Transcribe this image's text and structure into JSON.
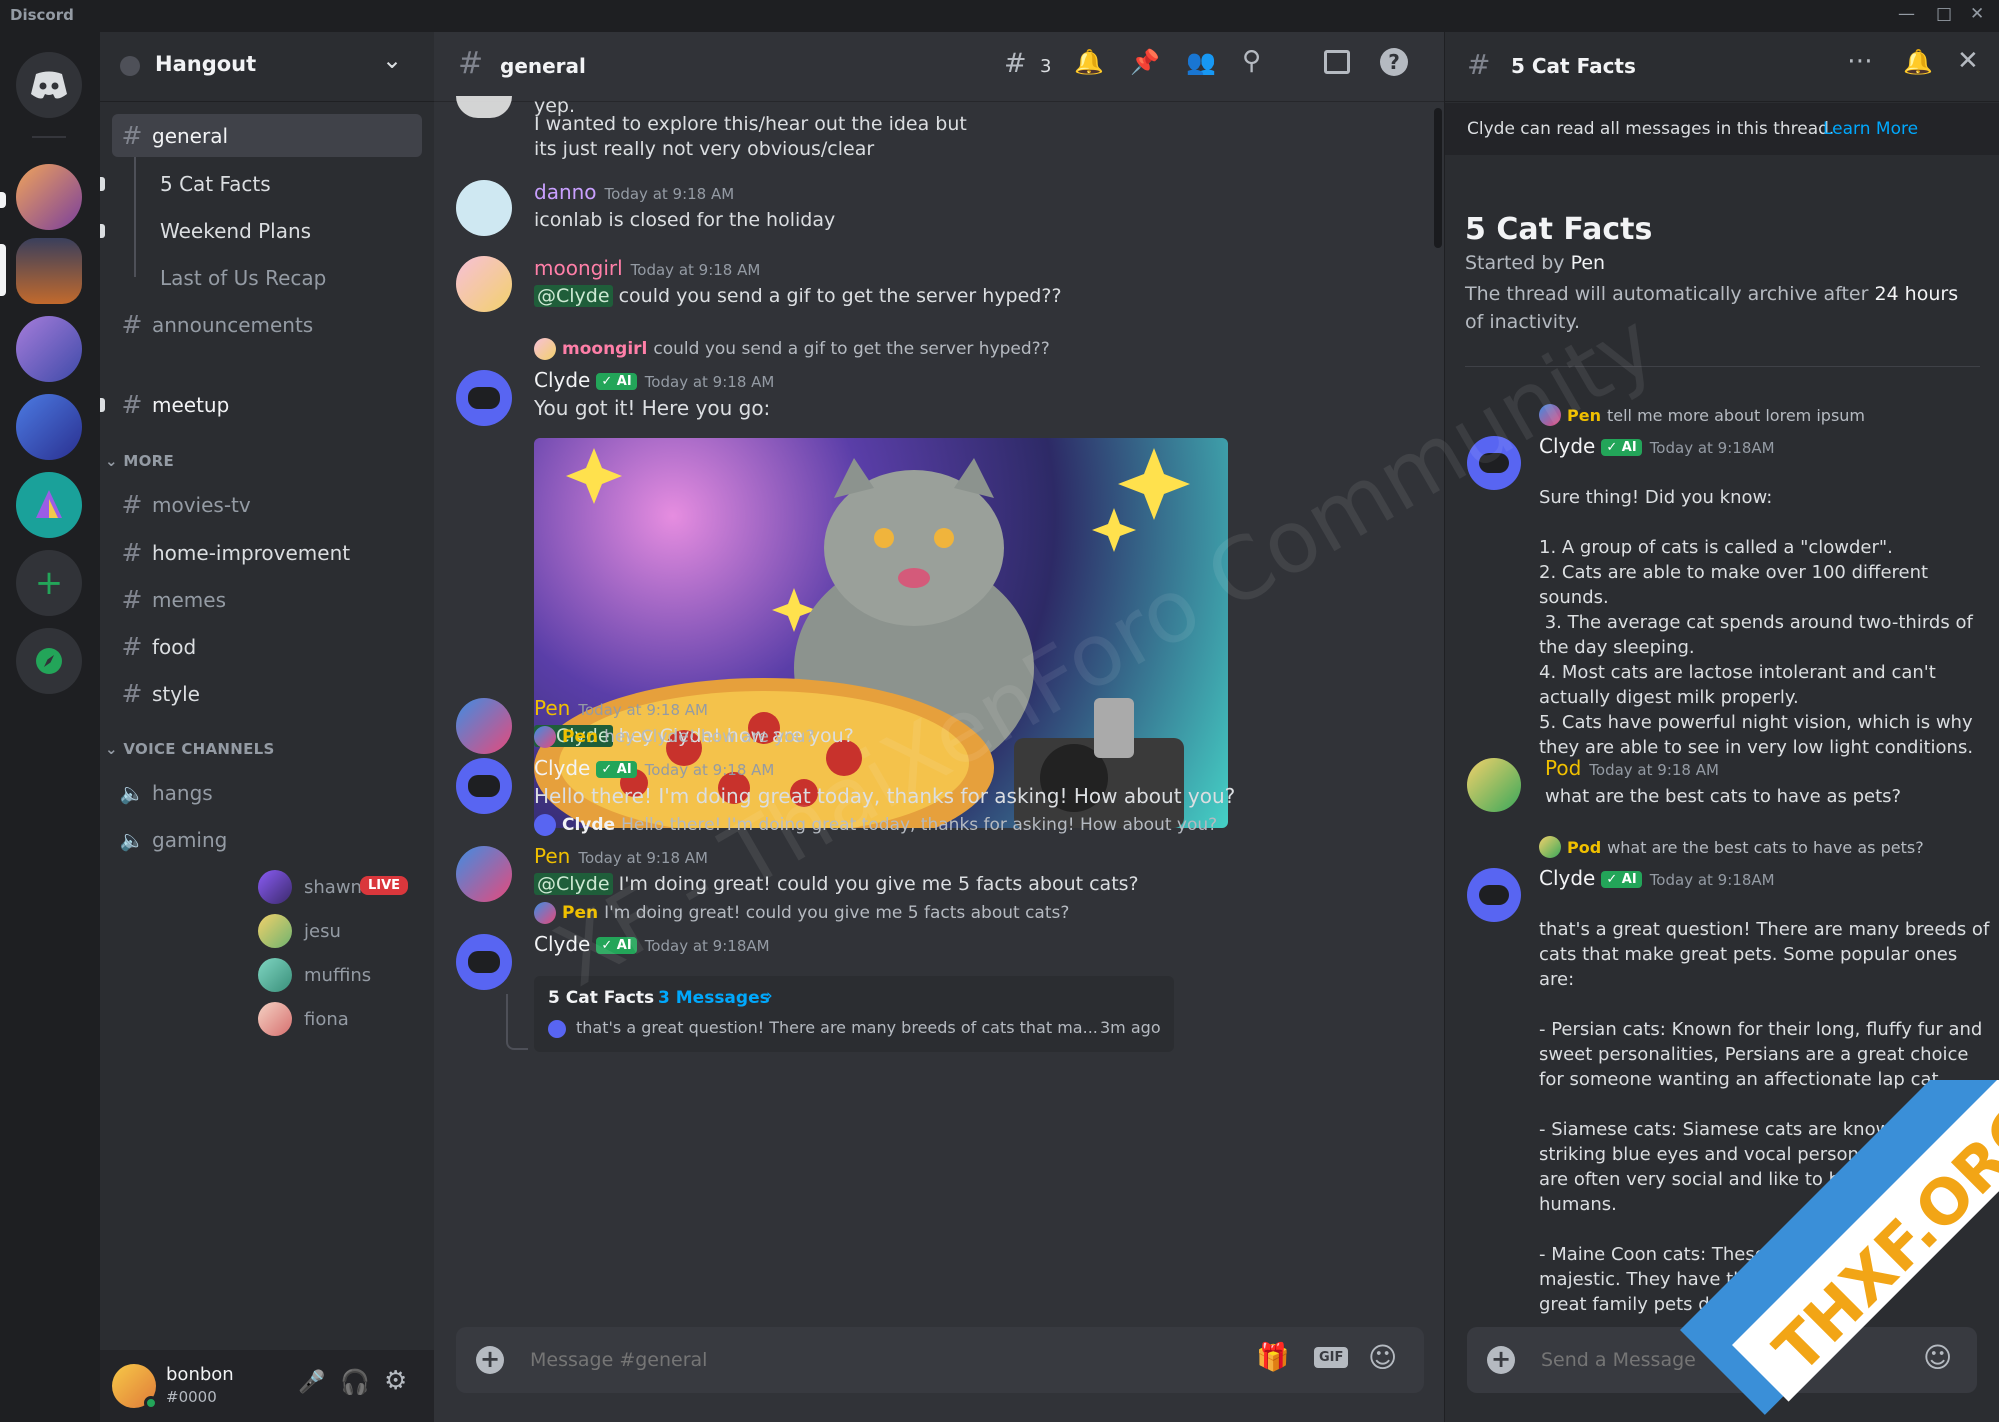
{
  "app": {
    "title": "Discord"
  },
  "colors": {
    "accent": "#5865f2",
    "green": "#23a559",
    "live": "#da373c",
    "link": "#00a8fc"
  },
  "server": {
    "name": "Hangout"
  },
  "channels": {
    "general": "general",
    "threads": [
      "5 Cat Facts",
      "Weekend Plans",
      "Last of Us Recap"
    ],
    "text": [
      "announcements",
      "meetup"
    ],
    "more_label": "MORE",
    "more": [
      "movies-tv",
      "home-improvement",
      "memes",
      "food",
      "style"
    ],
    "voice_label": "VOICE CHANNELS",
    "voice": [
      "hangs",
      "gaming"
    ],
    "voice_users": [
      {
        "name": "shawn",
        "badge": "LIVE"
      },
      {
        "name": "jesu"
      },
      {
        "name": "muffins"
      },
      {
        "name": "fiona"
      }
    ]
  },
  "user": {
    "name": "bonbon",
    "tag": "#0000"
  },
  "chat": {
    "channel": "general",
    "thread_count": "3",
    "composer_placeholder": "Message #general",
    "gif_label": "GIF",
    "top_lines": [
      "yep.",
      "I wanted to explore this/hear out the idea but",
      "its just really not very obvious/clear"
    ],
    "messages": [
      {
        "user": "danno",
        "time": "Today at 9:18 AM",
        "text": "iconlab is closed for the holiday"
      },
      {
        "user": "moongirl",
        "time": "Today at 9:18 AM",
        "mention": "@Clyde",
        "text": "could you send a gif to get the server hyped??"
      },
      {
        "reply_user": "moongirl",
        "reply_text": "could you send a gif to get the server hyped??",
        "user": "Clyde",
        "badge": "AI",
        "time": "Today at 9:18 AM",
        "text": "You got it! Here you go:"
      },
      {
        "user": "Pen",
        "time": "Today at 9:18 AM",
        "mention": "@Clyde",
        "text": "hey Clyde! how are you?"
      },
      {
        "reply_user": "Pen",
        "reply_text": "hey Clyde! how are you?",
        "user": "Clyde",
        "badge": "AI",
        "time": "Today at 9:18 AM",
        "text": "Hello there! I'm doing great today, thanks for asking! How about you?"
      },
      {
        "reply_user": "Clyde",
        "reply_text": "Hello there! I'm doing great today, thanks for asking! How about you?",
        "user": "Pen",
        "time": "Today at 9:18 AM",
        "mention": "@Clyde",
        "text": "I'm doing great! could you give me 5 facts about cats?"
      },
      {
        "reply_user": "Pen",
        "reply_text": "I'm doing great! could you give me 5 facts about cats?",
        "user": "Clyde",
        "badge": "AI",
        "time": "Today at 9:18AM"
      }
    ],
    "thread_card": {
      "name": "5 Cat Facts",
      "count": "3 Messages",
      "preview": "that's a great question! There are many breeds of cats that ma...",
      "age": "3m ago"
    }
  },
  "thread": {
    "title": "5 Cat Facts",
    "notice": "Clyde can read all messages in this thread.",
    "notice_link": "Learn More",
    "heading": "5 Cat Facts",
    "started_prefix": "Started by",
    "started_by": "Pen",
    "archive_pre": "The thread will automatically archive after",
    "archive_bold": "24 hours",
    "archive_post": "of inactivity.",
    "composer_placeholder": "Send a Message",
    "messages": [
      {
        "reply_user": "Pen",
        "reply_text": "tell me more about lorem ipsum",
        "user": "Clyde",
        "badge": "AI",
        "time": "Today at 9:18AM",
        "lines": [
          "Sure thing! Did you know:",
          "",
          "1. A group of cats is called a \"clowder\".",
          "2. Cats are able to make over 100 different",
          "sounds.",
          " 3. The average cat spends around two-thirds of",
          "the day sleeping.",
          "4. Most cats are lactose intolerant and can't",
          "actually digest milk properly.",
          "5. Cats have powerful night vision, which is why",
          "they are able to see in very low light conditions."
        ]
      },
      {
        "user": "Pod",
        "time": "Today at 9:18 AM",
        "lines": [
          "what are the best cats to have as pets?"
        ]
      },
      {
        "reply_user": "Pod",
        "reply_text": "what are the best cats to have as pets?",
        "user": "Clyde",
        "badge": "AI",
        "time": "Today at 9:18AM",
        "lines": [
          "that's a great question! There are many breeds of",
          "cats that make great pets. Some popular ones",
          "are:",
          "",
          "- Persian cats: Known for their long, fluffy fur and",
          "sweet personalities, Persians are a great choice",
          "for someone wanting an affectionate lap cat.",
          "",
          "- Siamese cats: Siamese cats are known for their",
          "striking blue eyes and vocal personalities. They",
          "are often very social and like to be near their",
          "humans.",
          "",
          "- Maine Coon cats: These cats are lar",
          "majestic. They have thick, fluffy fu",
          "great family pets due to their g"
        ]
      }
    ]
  },
  "overlay": {
    "watermark": "XF - ThaiXenForo Community",
    "corner": "THXF.ORG"
  }
}
